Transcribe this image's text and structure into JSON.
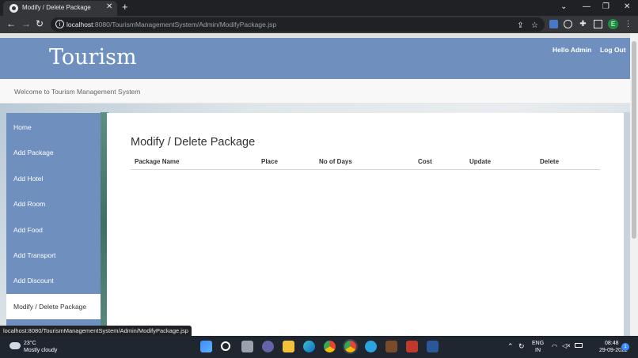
{
  "browser": {
    "tab_title": "Modify / Delete Package",
    "tab_close": "✕",
    "new_tab": "+",
    "url_host": "localhost",
    "url_rest": ":8080/TourismManagementSystem/Admin/ModifyPackage.jsp",
    "profile_initial": "E",
    "status_url": "localhost:8080/TourismManagementSystem/Admin/ModifyPackage.jsp"
  },
  "header": {
    "brand": "Tourism",
    "hello": "Hello Admin",
    "logout": "Log Out"
  },
  "welcome": "Welcome to Tourism Management System",
  "sidebar": {
    "items": [
      {
        "label": "Home"
      },
      {
        "label": "Add Package"
      },
      {
        "label": "Add Hotel"
      },
      {
        "label": "Add Room"
      },
      {
        "label": "Add Food"
      },
      {
        "label": "Add Transport"
      },
      {
        "label": "Add Discount"
      },
      {
        "label": "Modify / Delete Package"
      }
    ],
    "active_index": 7
  },
  "main": {
    "title": "Modify / Delete Package",
    "columns": [
      "Package Name",
      "Place",
      "No of Days",
      "Cost",
      "Update",
      "Delete"
    ],
    "rows": []
  },
  "taskbar": {
    "temp": "23°C",
    "condition": "Mostly cloudy",
    "lang_1": "ENG",
    "lang_2": "IN",
    "time": "08:48",
    "date": "29-09-2022",
    "notification_count": "1"
  },
  "colors": {
    "header_bg": "#6f8fbf",
    "sidebar_bg": "#6f8fbf"
  }
}
